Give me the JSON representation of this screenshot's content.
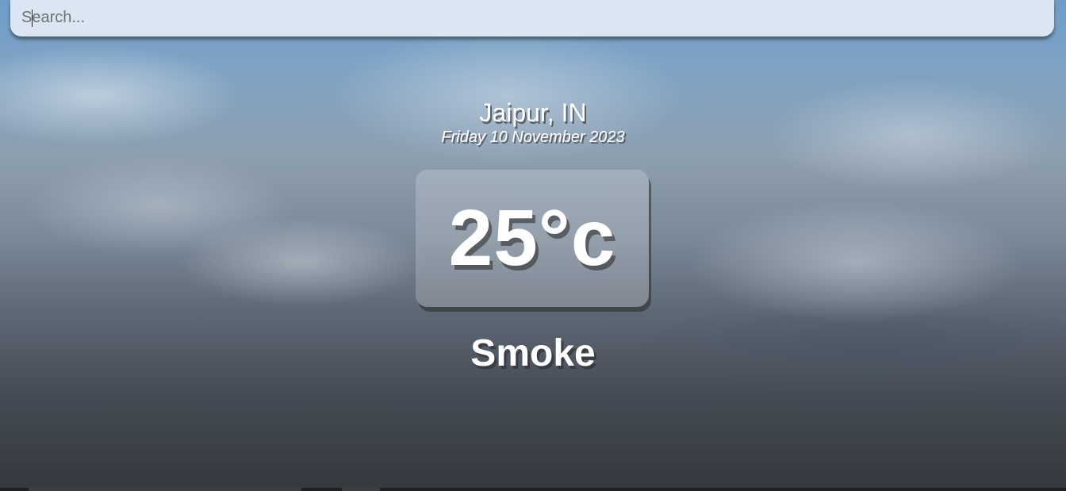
{
  "search": {
    "placeholder": "Search...",
    "value": ""
  },
  "location": {
    "city": "Jaipur, IN",
    "date": "Friday 10 November 2023"
  },
  "weather": {
    "temperature": "25°c",
    "condition": "Smoke"
  },
  "colors": {
    "text": "#ffffff",
    "search_bg": "#e8f0f8"
  }
}
